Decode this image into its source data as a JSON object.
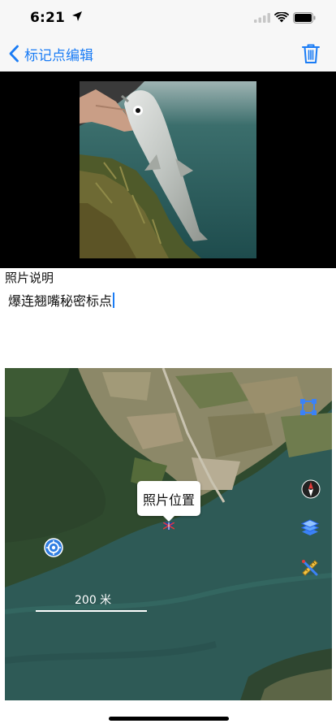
{
  "status_bar": {
    "time": "6:21",
    "icons": [
      "location-arrow-icon",
      "cellular-signal-icon",
      "wifi-icon",
      "battery-icon"
    ]
  },
  "nav": {
    "back_label": "标记点编辑",
    "back_icon": "chevron-left-icon",
    "delete_icon": "trash-icon",
    "accent_color": "#1a7cf5"
  },
  "photo": {
    "subject": "fish-photo"
  },
  "caption": {
    "label": "照片说明",
    "value": "爆连翘嘴秘密标点"
  },
  "map": {
    "callout_text": "照片位置",
    "scale_text": "200 米",
    "controls": [
      "measure-area-icon",
      "compass-icon",
      "layers-icon",
      "ruler-icon",
      "locate-icon"
    ],
    "water_color": "#2e5a56"
  }
}
